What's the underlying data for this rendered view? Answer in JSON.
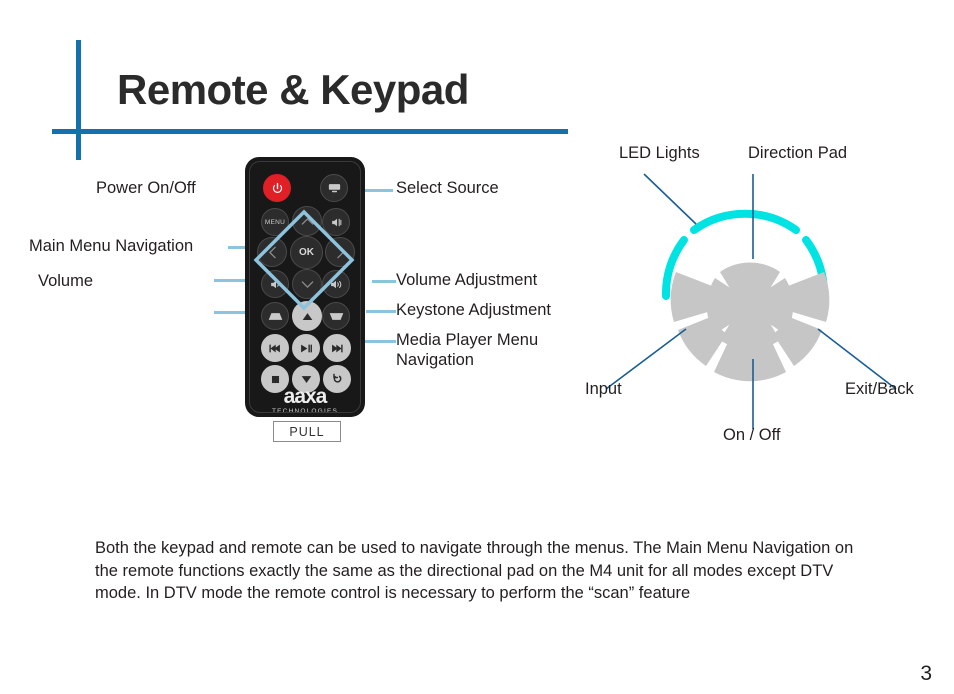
{
  "page": {
    "title": "Remote & Keypad",
    "number": "3",
    "accent_color": "#1372ac",
    "leader_color_remote": "#8cc3dd",
    "leader_color_keypad": "#1a5e96",
    "led_color": "#00e3e3",
    "keypad_segment_color": "#c6c6c6",
    "power_button_color": "#e01f26"
  },
  "remote": {
    "brand": "aaxa",
    "brand_sub": "TECHNOLOGIES",
    "pull_tab": "PULL",
    "menu_label": "MENU",
    "ok_label": "OK",
    "labels_left": [
      {
        "text": "Power On/Off",
        "name": "label-power-on-off"
      },
      {
        "text": "Main Menu Navigation",
        "name": "label-main-menu-navigation"
      },
      {
        "text": "Volume",
        "name": "label-volume"
      }
    ],
    "labels_right": [
      {
        "text": "Select Source",
        "name": "label-select-source"
      },
      {
        "text": "Volume Adjustment",
        "name": "label-volume-adjustment"
      },
      {
        "text": "Keystone Adjustment",
        "name": "label-keystone-adjustment"
      },
      {
        "text": "Media Player Menu Navigation",
        "name": "label-media-player-menu-navigation"
      }
    ],
    "buttons": [
      {
        "name": "power-button",
        "icon": "power-icon"
      },
      {
        "name": "source-button",
        "icon": "screen-icon"
      },
      {
        "name": "menu-button",
        "icon": "menu-text-icon"
      },
      {
        "name": "up-button",
        "icon": "chevron-up-icon"
      },
      {
        "name": "mute-button",
        "icon": "speaker-mute-icon"
      },
      {
        "name": "left-button",
        "icon": "chevron-left-icon"
      },
      {
        "name": "ok-button",
        "icon": "ok-text-icon"
      },
      {
        "name": "right-button",
        "icon": "chevron-right-icon"
      },
      {
        "name": "volume-down-button",
        "icon": "speaker-low-icon"
      },
      {
        "name": "down-button",
        "icon": "chevron-down-icon"
      },
      {
        "name": "volume-up-button",
        "icon": "speaker-high-icon"
      },
      {
        "name": "keystone-up-button",
        "icon": "trapezoid-up-icon"
      },
      {
        "name": "media-up-button",
        "icon": "triangle-up-icon"
      },
      {
        "name": "keystone-down-button",
        "icon": "trapezoid-down-icon"
      },
      {
        "name": "previous-button",
        "icon": "skip-back-icon"
      },
      {
        "name": "play-pause-button",
        "icon": "play-pause-icon"
      },
      {
        "name": "next-button",
        "icon": "skip-forward-icon"
      },
      {
        "name": "stop-button",
        "icon": "stop-icon"
      },
      {
        "name": "media-down-button",
        "icon": "triangle-down-icon"
      },
      {
        "name": "return-button",
        "icon": "return-arrow-icon"
      }
    ]
  },
  "keypad": {
    "labels": [
      {
        "text": "LED Lights",
        "name": "label-led-lights"
      },
      {
        "text": "Direction Pad",
        "name": "label-direction-pad"
      },
      {
        "text": "Input",
        "name": "label-input"
      },
      {
        "text": "Exit/Back",
        "name": "label-exit-back"
      },
      {
        "text": "On / Off",
        "name": "label-on-off"
      }
    ]
  },
  "body": {
    "paragraph": "Both the keypad and remote can be used to navigate through the menus.  The Main Menu Navigation on the remote functions exactly the same as the directional pad on the M4 unit for all modes except DTV mode.  In DTV mode the remote control is necessary to perform the “scan” feature"
  }
}
